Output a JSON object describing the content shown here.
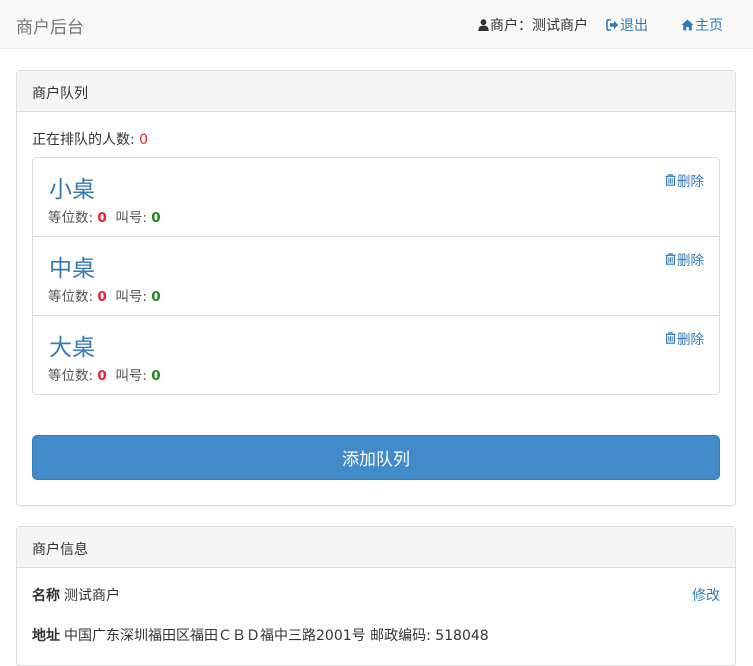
{
  "navbar": {
    "brand": "商户后台",
    "user_label": "商户：测试商户",
    "logout_label": "退出",
    "home_label": "主页"
  },
  "queue_panel": {
    "title": "商户队列",
    "count_label": "正在排队的人数: ",
    "count_value": "0",
    "items": [
      {
        "name": "小桌",
        "wait_label": "等位数: ",
        "wait_value": "0",
        "call_label": "叫号: ",
        "call_value": "0",
        "delete_label": "删除"
      },
      {
        "name": "中桌",
        "wait_label": "等位数: ",
        "wait_value": "0",
        "call_label": "叫号: ",
        "call_value": "0",
        "delete_label": "删除"
      },
      {
        "name": "大桌",
        "wait_label": "等位数: ",
        "wait_value": "0",
        "call_label": "叫号: ",
        "call_value": "0",
        "delete_label": "删除"
      }
    ],
    "add_button": "添加队列"
  },
  "info_panel": {
    "title": "商户信息",
    "name_label": "名称",
    "name_value": "测试商户",
    "edit_label": "修改",
    "address_label": "地址",
    "address_value": "中国广东深圳福田区福田ＣＢＤ福中三路2001号 邮政编码: 518048"
  },
  "colors": {
    "link": "#337ab7",
    "primary_button": "#428bca",
    "red_number": "#e4262a",
    "green_number": "#1a8a1a"
  },
  "icons": [
    "user-icon",
    "logout-icon",
    "home-icon",
    "trash-icon"
  ]
}
